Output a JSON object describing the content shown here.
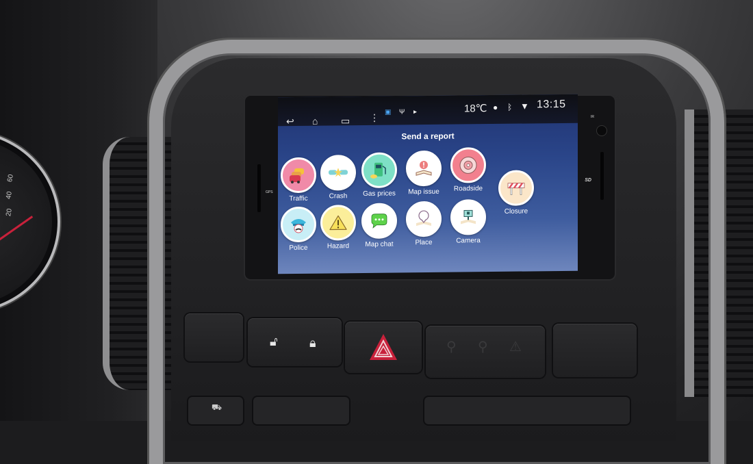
{
  "status_bar": {
    "nav": {
      "back_icon": "back-arrow-icon",
      "home_icon": "home-icon",
      "recents_icon": "recent-apps-icon",
      "menu_icon": "overflow-menu-icon"
    },
    "notification_icons": [
      "screen-icon",
      "usb-icon",
      "play-store-icon"
    ],
    "temperature": "18℃",
    "system_icons": [
      "location-icon",
      "bluetooth-icon",
      "wifi-icon"
    ],
    "time": "13:15"
  },
  "report_panel": {
    "title": "Send a report",
    "items": [
      {
        "id": "traffic",
        "label": "Traffic",
        "icon": "traffic-cars-icon",
        "color": "#f08aa8"
      },
      {
        "id": "crash",
        "label": "Crash",
        "icon": "crash-cars-icon",
        "color": "#ffffff"
      },
      {
        "id": "gas-prices",
        "label": "Gas prices",
        "icon": "fuel-pump-icon",
        "color": "#7ee0c6"
      },
      {
        "id": "map-issue",
        "label": "Map issue",
        "icon": "map-alert-icon",
        "color": "#ffffff"
      },
      {
        "id": "roadside",
        "label": "Roadside",
        "icon": "tire-icon",
        "color": "#f2808e"
      },
      {
        "id": "closure",
        "label": "Closure",
        "icon": "road-barrier-icon",
        "color": "#fbe6c9"
      },
      {
        "id": "police",
        "label": "Police",
        "icon": "police-cap-icon",
        "color": "#c8eef6"
      },
      {
        "id": "hazard",
        "label": "Hazard",
        "icon": "warning-triangle-icon",
        "color": "#fbee9a"
      },
      {
        "id": "map-chat",
        "label": "Map chat",
        "icon": "chat-bubble-icon",
        "color": "#ffffff"
      },
      {
        "id": "place",
        "label": "Place",
        "icon": "place-pin-icon",
        "color": "#ffffff"
      },
      {
        "id": "camera",
        "label": "Camera",
        "icon": "speed-camera-icon",
        "color": "#ffffff"
      }
    ]
  },
  "head_unit": {
    "left_label": "GPS",
    "right_label": "SD",
    "top_right_label": "IR"
  },
  "dashboard": {
    "gauge_ticks": [
      "20",
      "40",
      "60"
    ],
    "buttons": [
      {
        "id": "blank-left",
        "label": ""
      },
      {
        "id": "unlock",
        "icon": "unlock-icon"
      },
      {
        "id": "lock",
        "icon": "lock-icon"
      },
      {
        "id": "hazard-lights",
        "icon": "hazard-triangle-icon",
        "color": "#d5253a"
      },
      {
        "id": "airbag-indicator",
        "icon": "airbag-off-icon"
      },
      {
        "id": "blank-right",
        "label": ""
      }
    ]
  }
}
